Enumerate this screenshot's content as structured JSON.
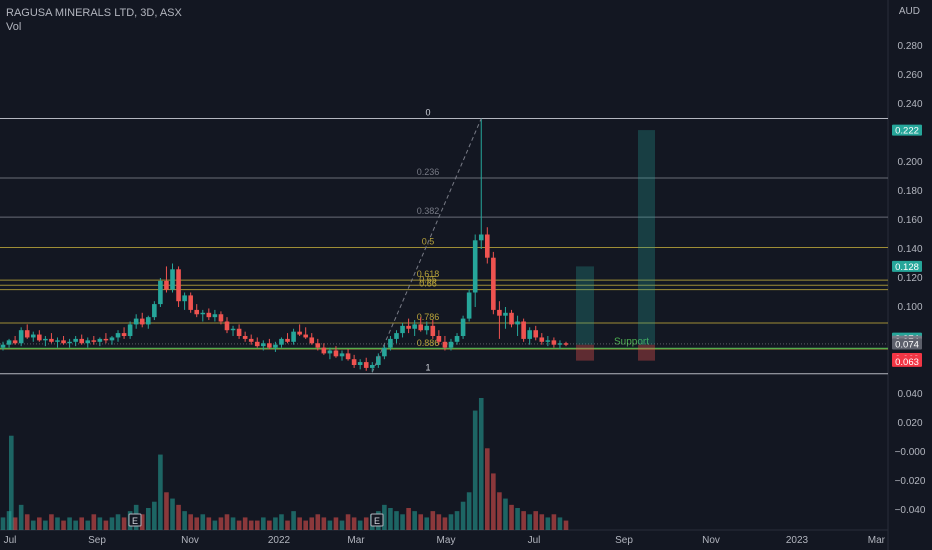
{
  "header": {
    "symbol_title": "RAGUSA MINERALS LTD, 3D, ASX",
    "volume_label": "Vol",
    "currency": "AUD"
  },
  "colors": {
    "background": "#131722",
    "up": "#26a69a",
    "down": "#ef5350",
    "fib_gold": "#b8a33a",
    "fib_white": "#d1d4dc",
    "support_green": "#4caf50",
    "grid_text": "#b2b5be"
  },
  "price_axis": {
    "ticks": [
      "0.280",
      "0.260",
      "0.240",
      "0.200",
      "0.180",
      "0.160",
      "0.140",
      "0.120",
      "0.100"
    ],
    "badges": [
      {
        "label": "0.222",
        "price": 0.222,
        "color": "#26a69a"
      },
      {
        "label": "0.128",
        "price": 0.128,
        "color": "#26a69a"
      },
      {
        "label": "0.074",
        "price": 0.0785,
        "color": "#26a69a"
      },
      {
        "label": "0.074",
        "price": 0.0765,
        "color": "#787b86"
      },
      {
        "label": "0.074",
        "price": 0.0745,
        "color": "#5d606b"
      },
      {
        "label": "0.063",
        "price": 0.0645,
        "color": "#f23645"
      },
      {
        "label": "0.063",
        "price": 0.0625,
        "color": "#f23645"
      }
    ]
  },
  "volume_axis": {
    "ticks": [
      "0.040",
      "0.020",
      "−0.000",
      "−0.020",
      "−0.040"
    ]
  },
  "time_axis": {
    "labels": [
      "Jul",
      "Sep",
      "Nov",
      "2022",
      "Mar",
      "May",
      "Jul",
      "Sep",
      "Nov",
      "2023",
      "Mar"
    ]
  },
  "fib": {
    "levels": [
      {
        "label": "0",
        "price": 0.23,
        "color": "#d1d4dc"
      },
      {
        "label": "0.236",
        "price": 0.189,
        "color": "#787b86"
      },
      {
        "label": "0.382",
        "price": 0.162,
        "color": "#787b86"
      },
      {
        "label": "0.5",
        "price": 0.141,
        "color": "#b8a33a"
      },
      {
        "label": "0.618",
        "price": 0.1185,
        "color": "#b8a33a"
      },
      {
        "label": "0.65",
        "price": 0.115,
        "color": "#b8a33a"
      },
      {
        "label": "0.66",
        "price": 0.112,
        "color": "#b8a33a"
      },
      {
        "label": "0.786",
        "price": 0.089,
        "color": "#b8a33a"
      },
      {
        "label": "0.886",
        "price": 0.071,
        "color": "#b8a33a"
      },
      {
        "label": "1",
        "price": 0.054,
        "color": "#d1d4dc"
      }
    ]
  },
  "annotations": {
    "support_label": "Support",
    "support_price": 0.0715,
    "earnings_markers": [
      "E",
      "E"
    ]
  },
  "chart_data": {
    "type": "candlestick",
    "title": "RAGUSA MINERALS LTD, 3D, ASX",
    "y_unit": "AUD",
    "ylim": [
      0.05,
      0.29
    ],
    "candles": [
      [
        0.072,
        0.076,
        0.07,
        0.074
      ],
      [
        0.074,
        0.078,
        0.072,
        0.077
      ],
      [
        0.077,
        0.08,
        0.074,
        0.075
      ],
      [
        0.075,
        0.086,
        0.073,
        0.084
      ],
      [
        0.084,
        0.088,
        0.078,
        0.079
      ],
      [
        0.079,
        0.083,
        0.076,
        0.081
      ],
      [
        0.081,
        0.084,
        0.076,
        0.077
      ],
      [
        0.077,
        0.08,
        0.073,
        0.078
      ],
      [
        0.078,
        0.082,
        0.075,
        0.076
      ],
      [
        0.076,
        0.079,
        0.072,
        0.077
      ],
      [
        0.077,
        0.08,
        0.074,
        0.075
      ],
      [
        0.075,
        0.078,
        0.072,
        0.076
      ],
      [
        0.076,
        0.08,
        0.073,
        0.078
      ],
      [
        0.078,
        0.081,
        0.074,
        0.075
      ],
      [
        0.075,
        0.079,
        0.072,
        0.077
      ],
      [
        0.077,
        0.08,
        0.074,
        0.076
      ],
      [
        0.076,
        0.079,
        0.073,
        0.078
      ],
      [
        0.078,
        0.082,
        0.075,
        0.077
      ],
      [
        0.077,
        0.08,
        0.074,
        0.079
      ],
      [
        0.079,
        0.084,
        0.076,
        0.082
      ],
      [
        0.082,
        0.086,
        0.078,
        0.08
      ],
      [
        0.08,
        0.09,
        0.078,
        0.088
      ],
      [
        0.088,
        0.095,
        0.085,
        0.092
      ],
      [
        0.092,
        0.096,
        0.086,
        0.088
      ],
      [
        0.088,
        0.094,
        0.085,
        0.093
      ],
      [
        0.093,
        0.104,
        0.091,
        0.102
      ],
      [
        0.102,
        0.12,
        0.1,
        0.118
      ],
      [
        0.118,
        0.128,
        0.11,
        0.112
      ],
      [
        0.112,
        0.13,
        0.11,
        0.126
      ],
      [
        0.126,
        0.128,
        0.1,
        0.104
      ],
      [
        0.104,
        0.11,
        0.098,
        0.108
      ],
      [
        0.108,
        0.11,
        0.096,
        0.098
      ],
      [
        0.098,
        0.102,
        0.093,
        0.095
      ],
      [
        0.095,
        0.098,
        0.09,
        0.096
      ],
      [
        0.096,
        0.099,
        0.091,
        0.093
      ],
      [
        0.093,
        0.098,
        0.09,
        0.095
      ],
      [
        0.095,
        0.097,
        0.088,
        0.09
      ],
      [
        0.09,
        0.093,
        0.082,
        0.084
      ],
      [
        0.084,
        0.087,
        0.08,
        0.085
      ],
      [
        0.085,
        0.088,
        0.078,
        0.08
      ],
      [
        0.08,
        0.083,
        0.076,
        0.078
      ],
      [
        0.078,
        0.081,
        0.074,
        0.076
      ],
      [
        0.076,
        0.079,
        0.072,
        0.073
      ],
      [
        0.073,
        0.077,
        0.07,
        0.075
      ],
      [
        0.075,
        0.078,
        0.071,
        0.072
      ],
      [
        0.072,
        0.076,
        0.069,
        0.074
      ],
      [
        0.074,
        0.079,
        0.072,
        0.078
      ],
      [
        0.078,
        0.082,
        0.075,
        0.076
      ],
      [
        0.076,
        0.085,
        0.074,
        0.083
      ],
      [
        0.083,
        0.088,
        0.08,
        0.081
      ],
      [
        0.081,
        0.086,
        0.078,
        0.079
      ],
      [
        0.079,
        0.082,
        0.074,
        0.075
      ],
      [
        0.075,
        0.078,
        0.07,
        0.072
      ],
      [
        0.072,
        0.075,
        0.067,
        0.068
      ],
      [
        0.068,
        0.072,
        0.064,
        0.07
      ],
      [
        0.07,
        0.073,
        0.065,
        0.066
      ],
      [
        0.066,
        0.07,
        0.063,
        0.068
      ],
      [
        0.068,
        0.071,
        0.063,
        0.064
      ],
      [
        0.064,
        0.067,
        0.058,
        0.06
      ],
      [
        0.06,
        0.064,
        0.057,
        0.062
      ],
      [
        0.062,
        0.065,
        0.056,
        0.058
      ],
      [
        0.058,
        0.062,
        0.055,
        0.06
      ],
      [
        0.06,
        0.068,
        0.058,
        0.066
      ],
      [
        0.066,
        0.074,
        0.064,
        0.072
      ],
      [
        0.072,
        0.08,
        0.07,
        0.078
      ],
      [
        0.078,
        0.084,
        0.075,
        0.082
      ],
      [
        0.082,
        0.089,
        0.079,
        0.087
      ],
      [
        0.087,
        0.092,
        0.082,
        0.085
      ],
      [
        0.085,
        0.091,
        0.08,
        0.088
      ],
      [
        0.088,
        0.093,
        0.083,
        0.084
      ],
      [
        0.084,
        0.09,
        0.081,
        0.087
      ],
      [
        0.087,
        0.091,
        0.078,
        0.08
      ],
      [
        0.08,
        0.084,
        0.074,
        0.076
      ],
      [
        0.076,
        0.08,
        0.07,
        0.072
      ],
      [
        0.072,
        0.078,
        0.07,
        0.076
      ],
      [
        0.076,
        0.082,
        0.074,
        0.08
      ],
      [
        0.08,
        0.094,
        0.078,
        0.092
      ],
      [
        0.092,
        0.112,
        0.09,
        0.11
      ],
      [
        0.11,
        0.15,
        0.1,
        0.146
      ],
      [
        0.146,
        0.23,
        0.14,
        0.15
      ],
      [
        0.15,
        0.155,
        0.13,
        0.134
      ],
      [
        0.134,
        0.138,
        0.095,
        0.098
      ],
      [
        0.098,
        0.104,
        0.078,
        0.094
      ],
      [
        0.094,
        0.1,
        0.085,
        0.096
      ],
      [
        0.096,
        0.098,
        0.086,
        0.088
      ],
      [
        0.088,
        0.094,
        0.08,
        0.09
      ],
      [
        0.09,
        0.092,
        0.076,
        0.078
      ],
      [
        0.078,
        0.086,
        0.074,
        0.084
      ],
      [
        0.084,
        0.087,
        0.077,
        0.079
      ],
      [
        0.079,
        0.082,
        0.074,
        0.076
      ],
      [
        0.076,
        0.08,
        0.073,
        0.077
      ],
      [
        0.077,
        0.079,
        0.072,
        0.074
      ],
      [
        0.074,
        0.077,
        0.071,
        0.075
      ],
      [
        0.075,
        0.076,
        0.073,
        0.074
      ]
    ],
    "volume": [
      0.004,
      0.006,
      0.004,
      0.008,
      0.005,
      0.003,
      0.004,
      0.003,
      0.005,
      0.004,
      0.003,
      0.004,
      0.003,
      0.004,
      0.003,
      0.005,
      0.004,
      0.003,
      0.004,
      0.005,
      0.004,
      0.006,
      0.008,
      0.005,
      0.007,
      0.009,
      0.024,
      0.012,
      0.01,
      0.008,
      0.006,
      0.005,
      0.004,
      0.005,
      0.004,
      0.003,
      0.004,
      0.005,
      0.004,
      0.003,
      0.004,
      0.003,
      0.003,
      0.004,
      0.003,
      0.004,
      0.005,
      0.003,
      0.006,
      0.004,
      0.003,
      0.004,
      0.005,
      0.004,
      0.003,
      0.004,
      0.003,
      0.005,
      0.004,
      0.003,
      0.004,
      0.005,
      0.006,
      0.008,
      0.007,
      0.006,
      0.005,
      0.007,
      0.006,
      0.005,
      0.004,
      0.006,
      0.005,
      0.004,
      0.005,
      0.006,
      0.009,
      0.012,
      0.038,
      0.042,
      0.026,
      0.018,
      0.012,
      0.01,
      0.008,
      0.007,
      0.006,
      0.005,
      0.006,
      0.005,
      0.004,
      0.005,
      0.004,
      0.003
    ],
    "volume_early_spike": 0.03
  }
}
